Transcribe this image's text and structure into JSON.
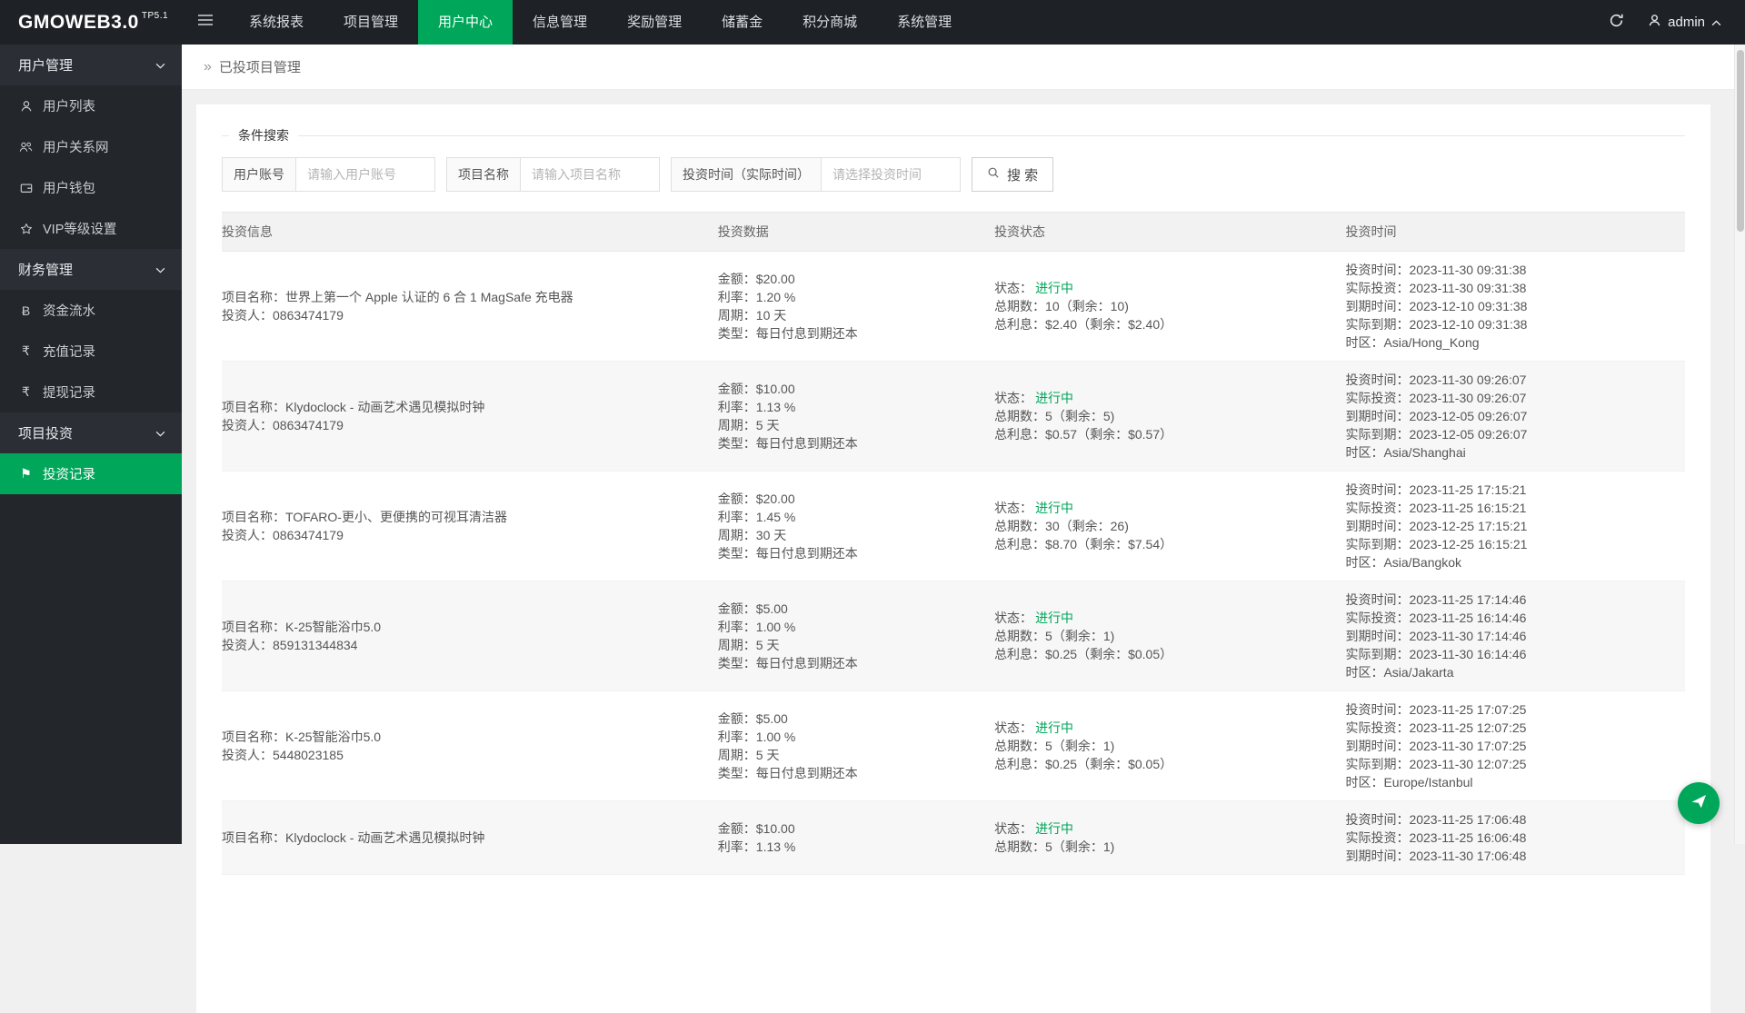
{
  "topbar": {
    "logo": "GMOWEB3.0",
    "logo_version": "TP5.1",
    "nav": [
      {
        "label": "系统报表"
      },
      {
        "label": "项目管理"
      },
      {
        "label": "用户中心"
      },
      {
        "label": "信息管理"
      },
      {
        "label": "奖励管理"
      },
      {
        "label": "储蓄金"
      },
      {
        "label": "积分商城"
      },
      {
        "label": "系统管理"
      }
    ],
    "user": "admin"
  },
  "sidebar": {
    "items": [
      {
        "label": "用户管理"
      },
      {
        "label": "用户列表"
      },
      {
        "label": "用户关系网"
      },
      {
        "label": "用户钱包"
      },
      {
        "label": "VIP等级设置"
      },
      {
        "label": "财务管理"
      },
      {
        "label": "资金流水"
      },
      {
        "label": "充值记录"
      },
      {
        "label": "提现记录"
      },
      {
        "label": "项目投资"
      },
      {
        "label": "投资记录"
      }
    ],
    "currency_icons": {
      "btc": "Ƀ",
      "rupee": "₹",
      "flag": "⚑",
      "star": "☆"
    }
  },
  "breadcrumb": {
    "arrow": "»",
    "title": "已投项目管理"
  },
  "search": {
    "legend": "条件搜索",
    "fields": [
      {
        "label": "用户账号",
        "placeholder": "请输入用户账号"
      },
      {
        "label": "项目名称",
        "placeholder": "请输入项目名称"
      },
      {
        "label": "投资时间（实际时间）",
        "placeholder": "请选择投资时间"
      }
    ],
    "button": "搜 索"
  },
  "table": {
    "headers": [
      "投资信息",
      "投资数据",
      "投资状态",
      "投资时间"
    ],
    "status_label": "状态：",
    "status_color": "#00a65a",
    "rows": [
      {
        "project": "项目名称：世界上第一个 Apple 认证的 6 合 1 MagSafe 充电器",
        "investor": "投资人：0863474179",
        "amount": "金额：$20.00",
        "rate": "利率：1.20 %",
        "cycle": "周期：10 天",
        "type": "类型：每日付息到期还本",
        "status": "进行中",
        "periods": "总期数：10（剩余：10)",
        "interest": "总利息：$2.40（剩余：$2.40）",
        "t1": "投资时间：2023-11-30 09:31:38",
        "t2": "实际投资：2023-11-30 09:31:38",
        "t3": "到期时间：2023-12-10 09:31:38",
        "t4": "实际到期：2023-12-10 09:31:38",
        "t5": "时区：Asia/Hong_Kong"
      },
      {
        "project": "项目名称：Klydoclock - 动画艺术遇见模拟时钟",
        "investor": "投资人：0863474179",
        "amount": "金额：$10.00",
        "rate": "利率：1.13 %",
        "cycle": "周期：5 天",
        "type": "类型：每日付息到期还本",
        "status": "进行中",
        "periods": "总期数：5（剩余：5)",
        "interest": "总利息：$0.57（剩余：$0.57）",
        "t1": "投资时间：2023-11-30 09:26:07",
        "t2": "实际投资：2023-11-30 09:26:07",
        "t3": "到期时间：2023-12-05 09:26:07",
        "t4": "实际到期：2023-12-05 09:26:07",
        "t5": "时区：Asia/Shanghai"
      },
      {
        "project": "项目名称：TOFARO-更小、更便携的可视耳清洁器",
        "investor": "投资人：0863474179",
        "amount": "金额：$20.00",
        "rate": "利率：1.45 %",
        "cycle": "周期：30 天",
        "type": "类型：每日付息到期还本",
        "status": "进行中",
        "periods": "总期数：30（剩余：26)",
        "interest": "总利息：$8.70（剩余：$7.54）",
        "t1": "投资时间：2023-11-25 17:15:21",
        "t2": "实际投资：2023-11-25 16:15:21",
        "t3": "到期时间：2023-12-25 17:15:21",
        "t4": "实际到期：2023-12-25 16:15:21",
        "t5": "时区：Asia/Bangkok"
      },
      {
        "project": "项目名称：K-25智能浴巾5.0",
        "investor": "投资人：859131344834",
        "amount": "金额：$5.00",
        "rate": "利率：1.00 %",
        "cycle": "周期：5 天",
        "type": "类型：每日付息到期还本",
        "status": "进行中",
        "periods": "总期数：5（剩余：1)",
        "interest": "总利息：$0.25（剩余：$0.05）",
        "t1": "投资时间：2023-11-25 17:14:46",
        "t2": "实际投资：2023-11-25 16:14:46",
        "t3": "到期时间：2023-11-30 17:14:46",
        "t4": "实际到期：2023-11-30 16:14:46",
        "t5": "时区：Asia/Jakarta"
      },
      {
        "project": "项目名称：K-25智能浴巾5.0",
        "investor": "投资人：5448023185",
        "amount": "金额：$5.00",
        "rate": "利率：1.00 %",
        "cycle": "周期：5 天",
        "type": "类型：每日付息到期还本",
        "status": "进行中",
        "periods": "总期数：5（剩余：1)",
        "interest": "总利息：$0.25（剩余：$0.05）",
        "t1": "投资时间：2023-11-25 17:07:25",
        "t2": "实际投资：2023-11-25 12:07:25",
        "t3": "到期时间：2023-11-30 17:07:25",
        "t4": "实际到期：2023-11-30 12:07:25",
        "t5": "时区：Europe/Istanbul"
      },
      {
        "project": "项目名称：Klydoclock - 动画艺术遇见模拟时钟",
        "investor": "",
        "amount": "金额：$10.00",
        "rate": "利率：1.13 %",
        "cycle": "",
        "type": "",
        "status": "进行中",
        "periods": "总期数：5（剩余：1)",
        "interest": "",
        "t1": "投资时间：2023-11-25 17:06:48",
        "t2": "实际投资：2023-11-25 16:06:48",
        "t3": "到期时间：2023-11-30 17:06:48",
        "t4": "",
        "t5": ""
      }
    ]
  },
  "colors": {
    "accent": "#00a65a",
    "topbar_bg": "#1e2126",
    "sidebar_bg": "#23262b"
  }
}
